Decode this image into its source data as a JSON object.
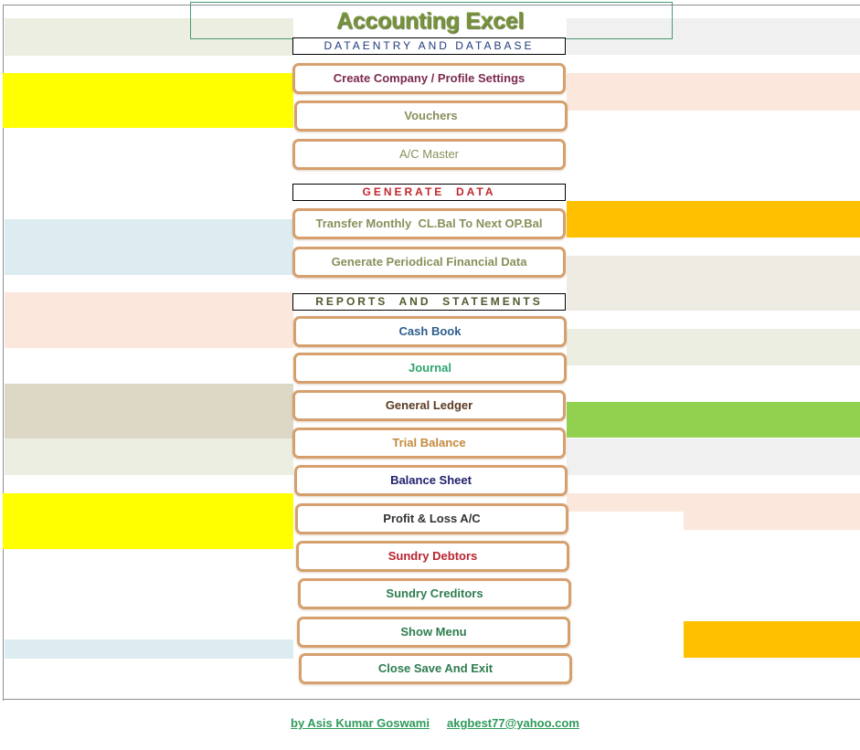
{
  "app": {
    "title": "Accounting Excel",
    "title_color": "#77933c"
  },
  "sections": {
    "data_entry": {
      "label": "DATAENTRY AND DATABASE",
      "color": "#1f3a7a"
    },
    "generate": {
      "label": "GENERATE  DATA",
      "color": "#c0282e"
    },
    "reports": {
      "label": "REPORTS  AND  STATEMENTS",
      "color": "#4f5a2e"
    }
  },
  "buttons": {
    "create_company": {
      "label": "Create Company / Profile Settings",
      "color": "#7b2a4f"
    },
    "vouchers": {
      "label": "Vouchers",
      "color": "#8a8f5a"
    },
    "ac_master": {
      "label": "A/C  Master",
      "color": "#8a8f5a"
    },
    "transfer_balance": {
      "label": "Transfer Monthly  CL.Bal To Next OP.Bal",
      "color": "#8a8f5a"
    },
    "generate_periodical": {
      "label": "Generate Periodical Financial Data",
      "color": "#8a8f5a"
    },
    "cash_book": {
      "label": "Cash Book",
      "color": "#2f5e8c"
    },
    "journal": {
      "label": "Journal",
      "color": "#2ea56c"
    },
    "general_ledger": {
      "label": "General Ledger",
      "color": "#5a3a22"
    },
    "trial_balance": {
      "label": "Trial Balance",
      "color": "#c58a3e"
    },
    "balance_sheet": {
      "label": "Balance Sheet",
      "color": "#1f1f6e"
    },
    "profit_loss": {
      "label": "Profit & Loss A/C",
      "color": "#333333"
    },
    "sundry_debtors": {
      "label": "Sundry Debtors",
      "color": "#b8232f"
    },
    "sundry_creditors": {
      "label": "Sundry Creditors",
      "color": "#2e7d4f"
    },
    "show_menu": {
      "label": "Show Menu",
      "color": "#2e7d4f"
    },
    "close_save_exit": {
      "label": "Close Save And Exit",
      "color": "#2e7d4f"
    }
  },
  "footer": {
    "author": "by Asis Kumar Goswami",
    "email": "akgbest77@yahoo.com",
    "link_color": "#2e9a5a"
  },
  "background_bands": {
    "colors": {
      "sage": "#ebeee0",
      "yellow": "#ffff00",
      "light_blue": "#dcecf1",
      "peach": "#fbe7dc",
      "taupe": "#ddd7c5",
      "light_gray": "#f0f0f0",
      "amber": "#ffc000",
      "stone": "#eeece2",
      "green": "#92d050"
    }
  }
}
